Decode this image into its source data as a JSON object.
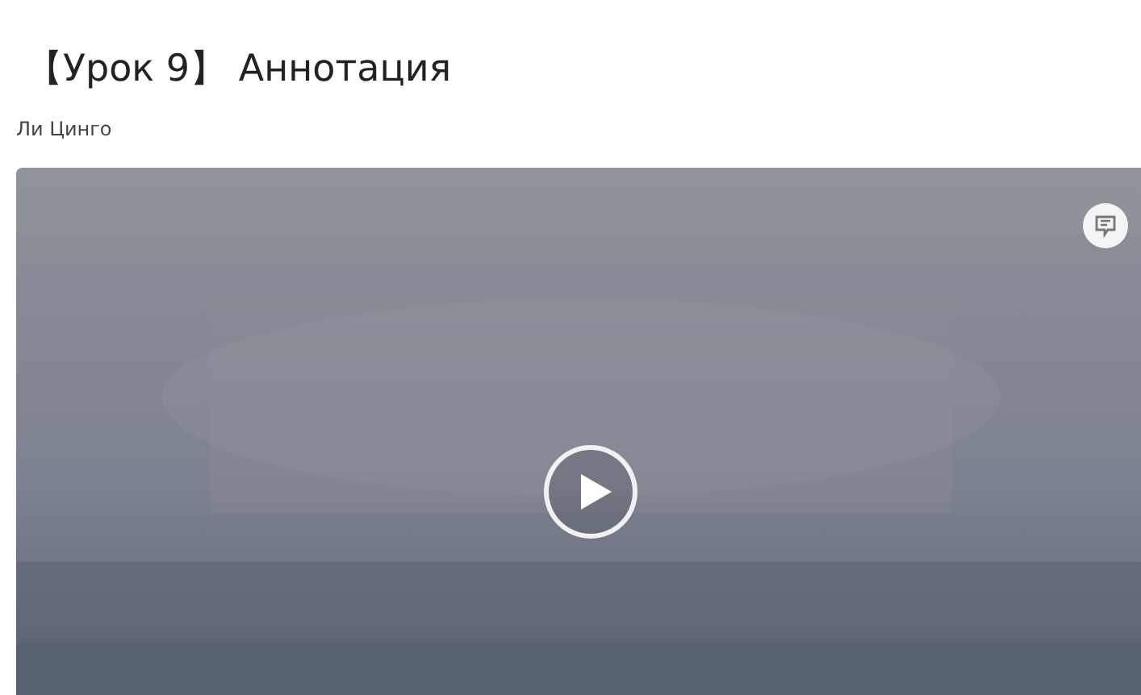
{
  "title": "【Урок 9】 Аннотация",
  "author": "Ли Цинго"
}
